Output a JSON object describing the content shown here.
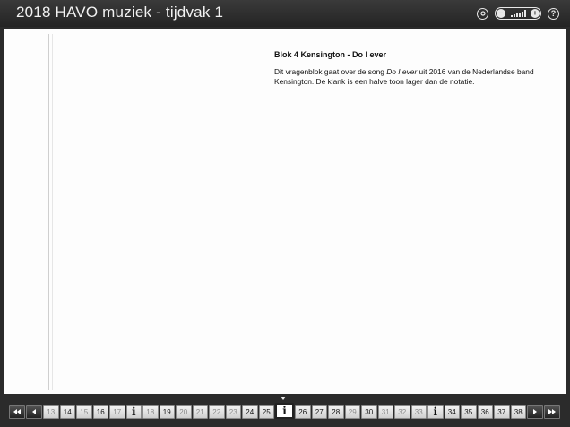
{
  "window": {
    "title": "2018 HAVO muziek - tijdvak 1",
    "icons": [
      "settings-icon",
      "volume-control",
      "help-icon"
    ],
    "help_symbol": "?"
  },
  "content": {
    "heading": "Blok 4   Kensington - Do I ever",
    "paragraph_before": "Dit vragenblok gaat over de song ",
    "song_title": "Do I ever",
    "paragraph_after": " uit 2016 van de Nederlandse band Kensington. De klank is een halve toon lager dan de notatie."
  },
  "navigation": {
    "first_icon": "double-chevron-left-icon",
    "prev_icon": "chevron-left-icon",
    "next_icon": "chevron-right-icon",
    "last_icon": "double-chevron-right-icon",
    "info_symbol": "i",
    "items": [
      {
        "label": "13",
        "type": "num",
        "dim": true
      },
      {
        "label": "14",
        "type": "num",
        "dim": false
      },
      {
        "label": "15",
        "type": "num",
        "dim": true
      },
      {
        "label": "16",
        "type": "num",
        "dim": false
      },
      {
        "label": "17",
        "type": "num",
        "dim": true
      },
      {
        "label": "i",
        "type": "info",
        "dim": false
      },
      {
        "label": "18",
        "type": "num",
        "dim": true
      },
      {
        "label": "19",
        "type": "num",
        "dim": false
      },
      {
        "label": "20",
        "type": "num",
        "dim": true
      },
      {
        "label": "21",
        "type": "num",
        "dim": true
      },
      {
        "label": "22",
        "type": "num",
        "dim": true
      },
      {
        "label": "23",
        "type": "num",
        "dim": true
      },
      {
        "label": "24",
        "type": "num",
        "dim": false
      },
      {
        "label": "25",
        "type": "num",
        "dim": false
      },
      {
        "label": "i",
        "type": "info",
        "dim": false,
        "current": true
      },
      {
        "label": "26",
        "type": "num",
        "dim": false
      },
      {
        "label": "27",
        "type": "num",
        "dim": false
      },
      {
        "label": "28",
        "type": "num",
        "dim": false
      },
      {
        "label": "29",
        "type": "num",
        "dim": true
      },
      {
        "label": "30",
        "type": "num",
        "dim": false
      },
      {
        "label": "31",
        "type": "num",
        "dim": true
      },
      {
        "label": "32",
        "type": "num",
        "dim": true
      },
      {
        "label": "33",
        "type": "num",
        "dim": true
      },
      {
        "label": "i",
        "type": "info",
        "dim": false
      },
      {
        "label": "34",
        "type": "num",
        "dim": false
      },
      {
        "label": "35",
        "type": "num",
        "dim": false
      },
      {
        "label": "36",
        "type": "num",
        "dim": false
      },
      {
        "label": "37",
        "type": "num",
        "dim": false
      },
      {
        "label": "38",
        "type": "num",
        "dim": false
      }
    ]
  }
}
